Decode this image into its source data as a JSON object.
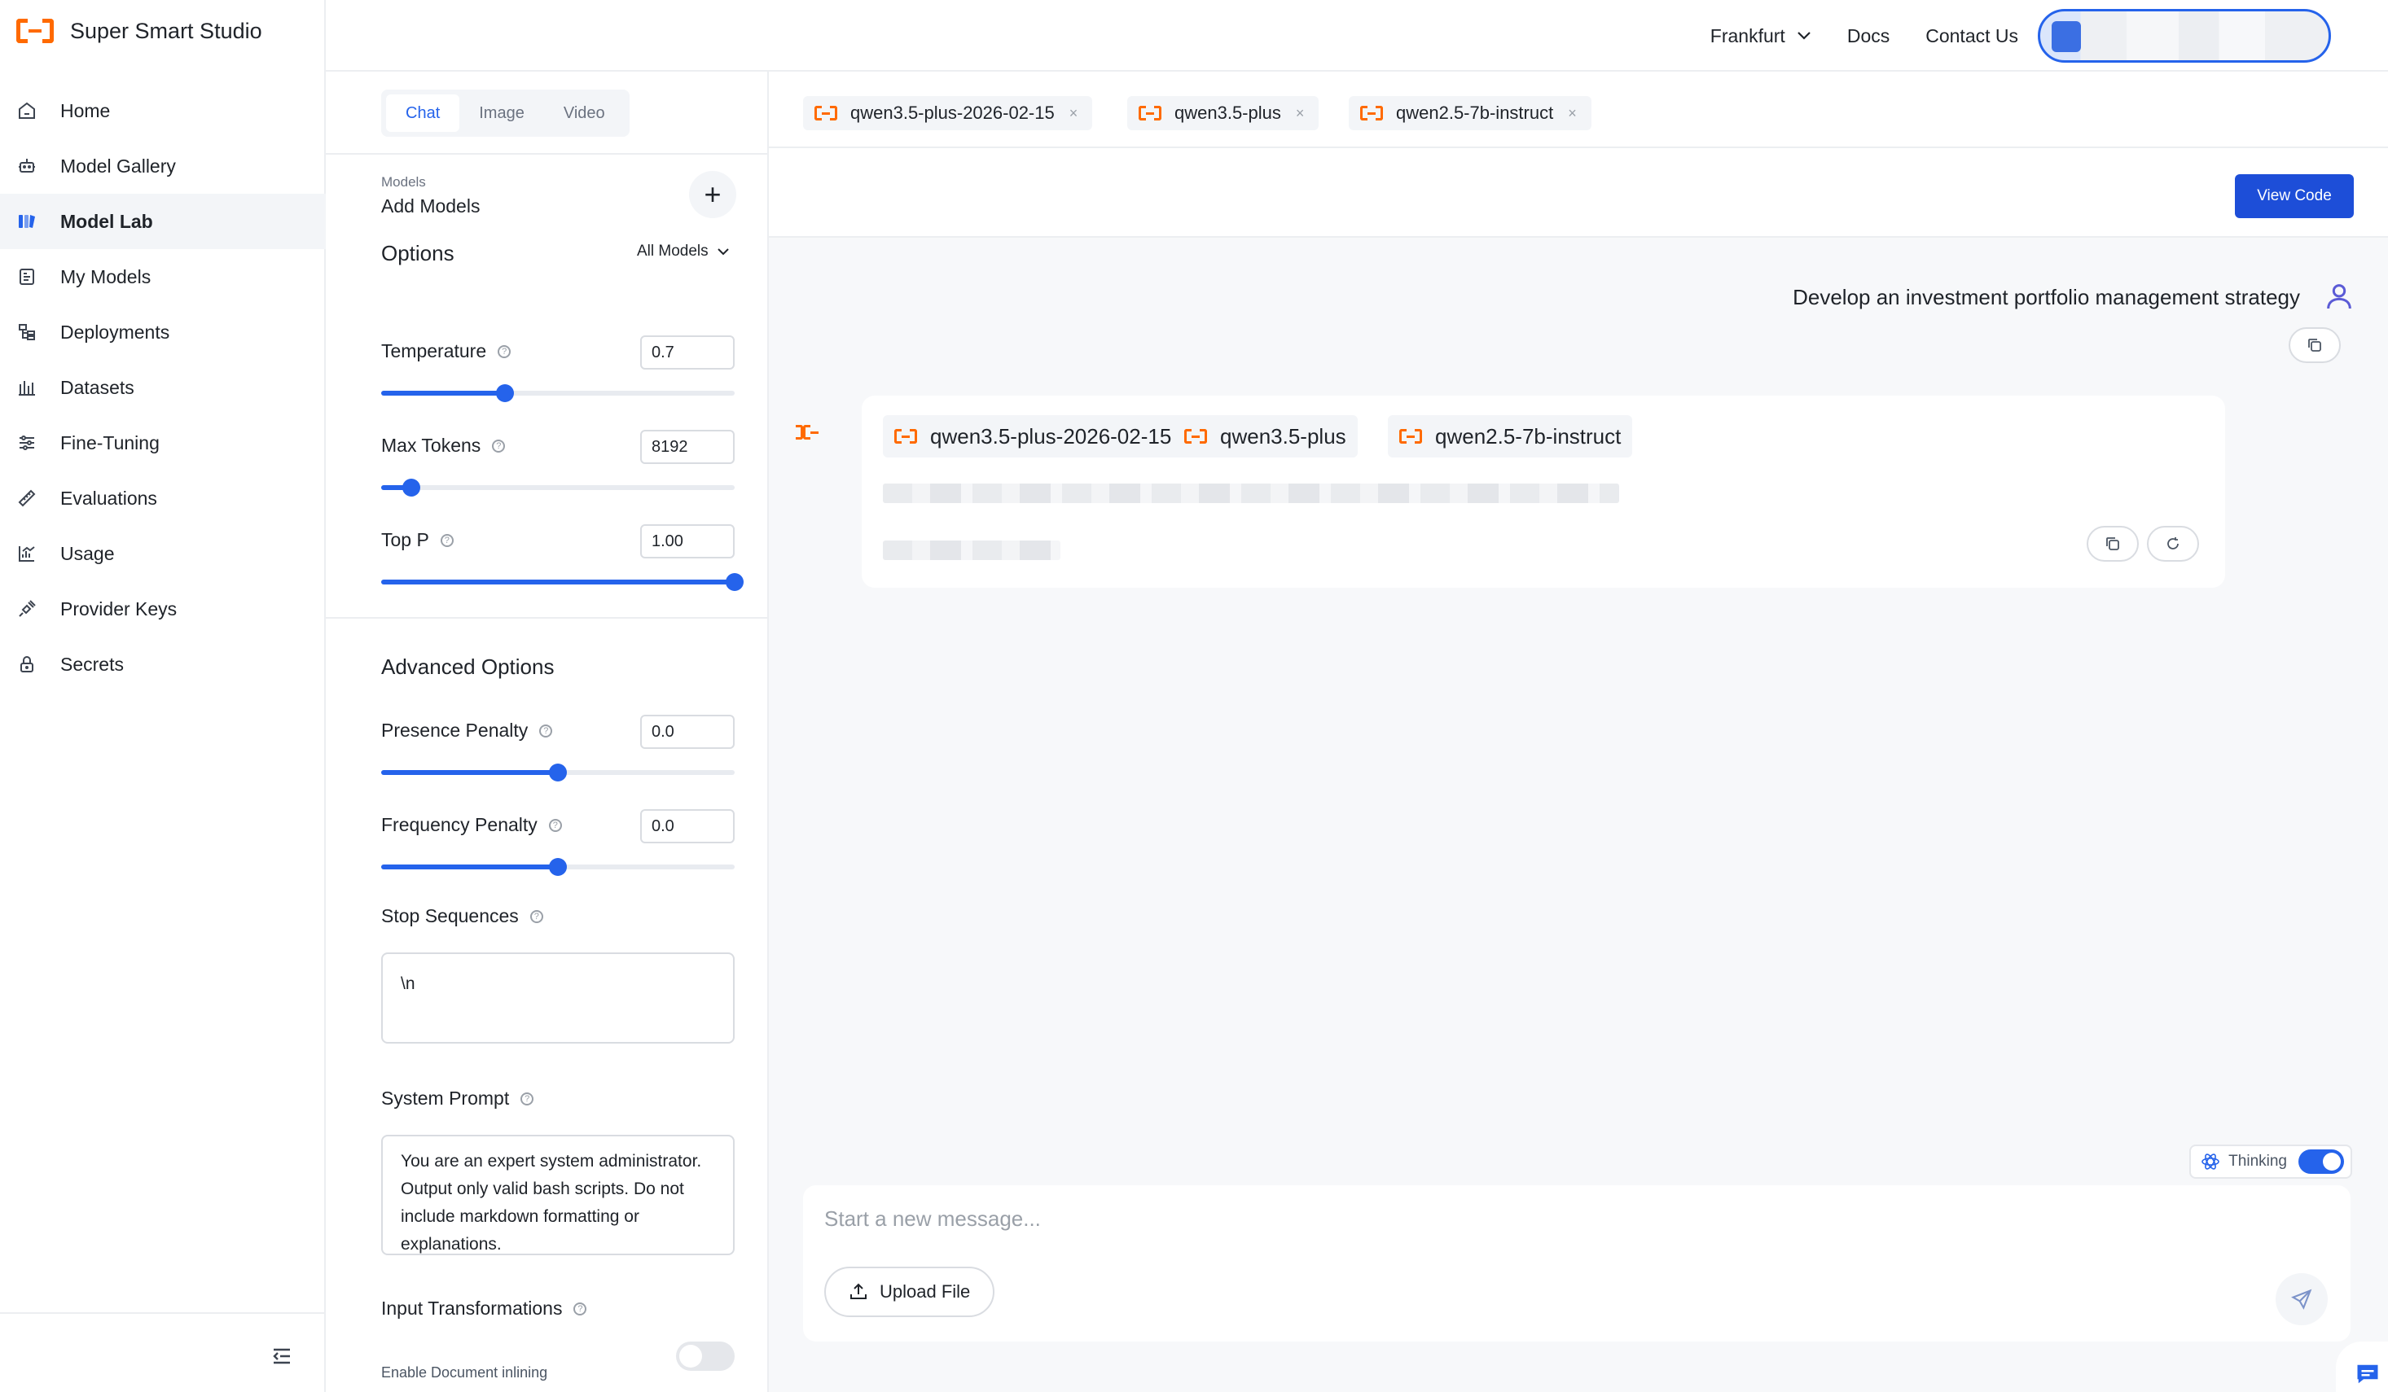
{
  "app": {
    "title": "Super Smart Studio"
  },
  "sidebar": {
    "items": [
      {
        "label": "Home",
        "icon": "home-icon"
      },
      {
        "label": "Model Gallery",
        "icon": "robot-icon"
      },
      {
        "label": "Model Lab",
        "icon": "lab-icon",
        "active": true
      },
      {
        "label": "My Models",
        "icon": "my-models-icon"
      },
      {
        "label": "Deployments",
        "icon": "deployments-icon"
      },
      {
        "label": "Datasets",
        "icon": "datasets-icon"
      },
      {
        "label": "Fine-Tuning",
        "icon": "sliders-icon"
      },
      {
        "label": "Evaluations",
        "icon": "ruler-icon"
      },
      {
        "label": "Usage",
        "icon": "usage-chart-icon"
      },
      {
        "label": "Provider Keys",
        "icon": "plug-icon"
      },
      {
        "label": "Secrets",
        "icon": "lock-icon"
      }
    ]
  },
  "topbar": {
    "region": "Frankfurt",
    "docs": "Docs",
    "contact": "Contact Us"
  },
  "config": {
    "tabs": [
      "Chat",
      "Image",
      "Video"
    ],
    "active_tab": "Chat",
    "models_caption": "Models",
    "models_add": "Add Models",
    "options_title": "Options",
    "all_models": "All Models",
    "temperature": {
      "label": "Temperature",
      "value": "0.7",
      "fraction": 0.35
    },
    "max_tokens": {
      "label": "Max Tokens",
      "value": "8192",
      "fraction": 0.085
    },
    "top_p": {
      "label": "Top P",
      "value": "1.00",
      "fraction": 1.0
    },
    "advanced_title": "Advanced Options",
    "presence_penalty": {
      "label": "Presence Penalty",
      "value": "0.0",
      "fraction": 0.5
    },
    "frequency_penalty": {
      "label": "Frequency Penalty",
      "value": "0.0",
      "fraction": 0.5
    },
    "stop_sequences": {
      "label": "Stop Sequences",
      "value": "\\n"
    },
    "system_prompt": {
      "label": "System Prompt",
      "value": "You are an expert system administrator. Output only valid bash scripts. Do not include markdown formatting or explanations."
    },
    "input_transformations": {
      "label": "Input Transformations"
    },
    "document_inlining": {
      "label": "Enable Document inlining",
      "enabled": false
    }
  },
  "main": {
    "model_chips": [
      "qwen3.5-plus-2026-02-15",
      "qwen3.5-plus",
      "qwen2.5-7b-instruct"
    ],
    "view_code": "View Code",
    "user_message": "Develop an investment portfolio management strategy",
    "response_models": [
      "qwen3.5-plus-2026-02-15",
      "qwen3.5-plus",
      "qwen2.5-7b-instruct"
    ],
    "thinking_label": "Thinking",
    "thinking_enabled": true,
    "composer_placeholder": "Start a new message...",
    "upload_label": "Upload File"
  },
  "colors": {
    "accent": "#2563eb",
    "brand": "#ff6a00"
  }
}
